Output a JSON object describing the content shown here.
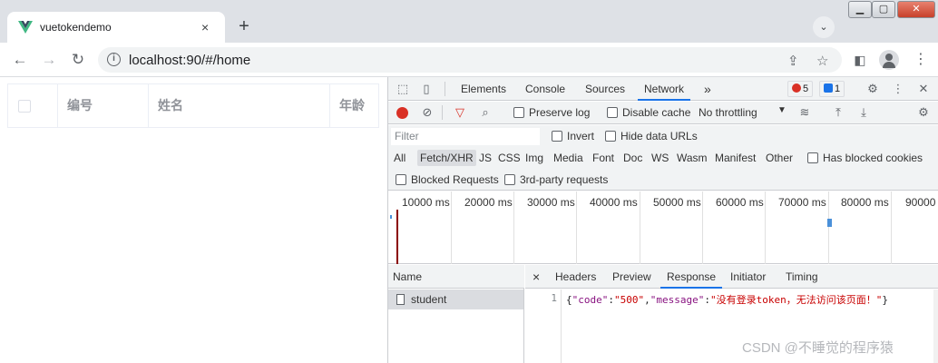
{
  "browser": {
    "tab_title": "vuetokendemo",
    "tab_close": "×",
    "new_tab": "+",
    "url": "localhost:90/#/home"
  },
  "table": {
    "headers": [
      "编号",
      "姓名",
      "年龄"
    ]
  },
  "devtools": {
    "tabs": [
      "Elements",
      "Console",
      "Sources",
      "Network"
    ],
    "more_tabs": "»",
    "error_count": "5",
    "message_count": "1",
    "network_toolbar": {
      "preserve_log": "Preserve log",
      "disable_cache": "Disable cache",
      "throttling": "No throttling"
    },
    "filter": {
      "placeholder": "Filter",
      "invert": "Invert",
      "hide_data_urls": "Hide data URLs"
    },
    "types": [
      "All",
      "Fetch/XHR",
      "JS",
      "CSS",
      "Img",
      "Media",
      "Font",
      "Doc",
      "WS",
      "Wasm",
      "Manifest",
      "Other"
    ],
    "has_blocked_cookies": "Has blocked cookies",
    "blocked_requests": "Blocked Requests",
    "third_party": "3rd-party requests",
    "timeline_labels": [
      "10000 ms",
      "20000 ms",
      "30000 ms",
      "40000 ms",
      "50000 ms",
      "60000 ms",
      "70000 ms",
      "80000 ms",
      "90000"
    ],
    "name_header": "Name",
    "requests": [
      "student"
    ],
    "detail_tabs": [
      "Headers",
      "Preview",
      "Response",
      "Initiator",
      "Timing"
    ],
    "detail_close": "×",
    "response": {
      "line_number": "1",
      "code_key": "\"code\"",
      "code_val": "\"500\"",
      "message_key": "\"message\"",
      "message_val": "\"没有登录token，无法访问该页面！\""
    }
  },
  "watermark": "CSDN @不睡觉的程序猿",
  "colors": {
    "accent": "#1a73e8",
    "record": "#d93025",
    "vue_green": "#41b883"
  }
}
